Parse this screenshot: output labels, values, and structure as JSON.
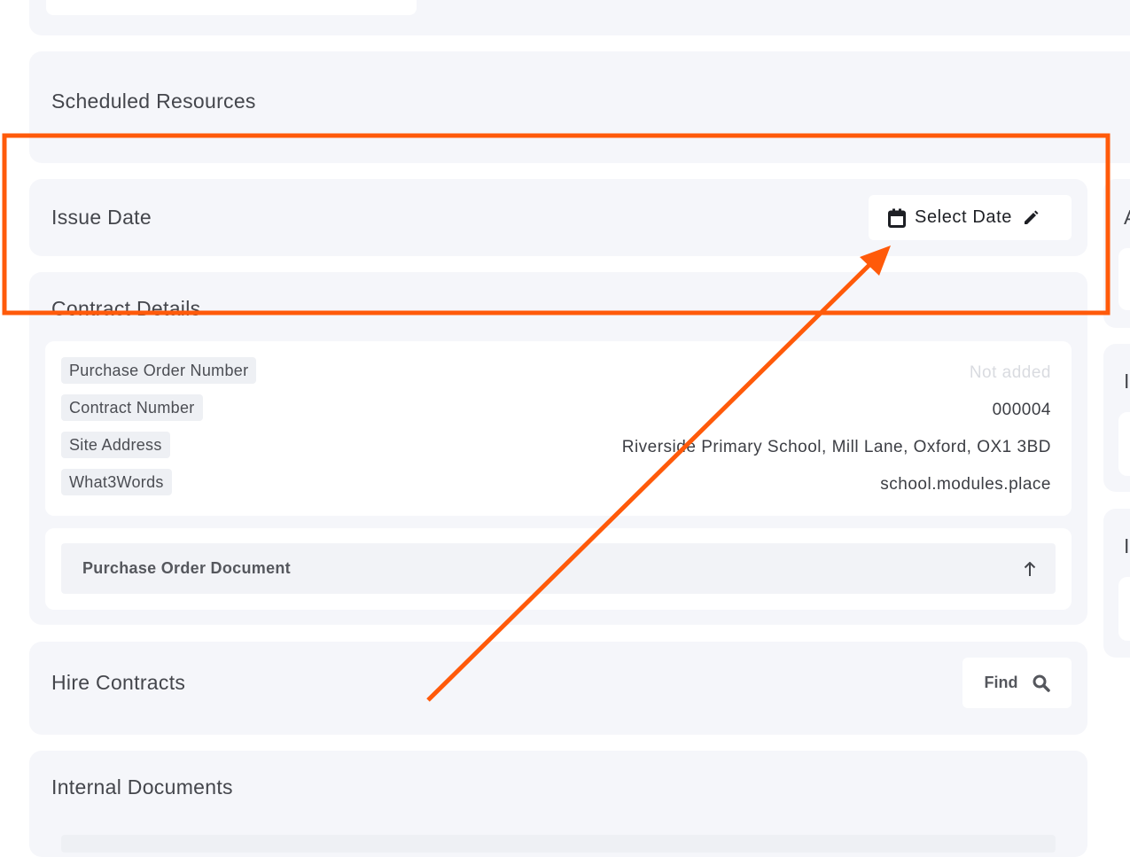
{
  "sections": {
    "scheduled_resources": {
      "title": "Scheduled Resources"
    },
    "issue_date": {
      "title": "Issue Date",
      "select_label": "Select Date"
    },
    "contract_details": {
      "title": "Contract Details",
      "rows": [
        {
          "label": "Purchase Order Number",
          "value": "Not added"
        },
        {
          "label": "Contract Number",
          "value": "000004"
        },
        {
          "label": "Site Address",
          "value": "Riverside Primary School, Mill Lane, Oxford, OX1 3BD"
        },
        {
          "label": "What3Words",
          "value": "school.modules.place"
        }
      ],
      "document_label": "Purchase Order Document"
    },
    "hire_contracts": {
      "title": "Hire Contracts",
      "find_label": "Find"
    },
    "internal_documents": {
      "title": "Internal Documents"
    }
  },
  "right_column": {
    "letters": [
      "A",
      "I",
      "I"
    ]
  },
  "annotation": {
    "color": "#ff5a0a"
  },
  "icons": {
    "calendar": "calendar-icon",
    "pencil": "pencil-icon",
    "upload": "arrow-up-icon",
    "search": "search-icon"
  }
}
